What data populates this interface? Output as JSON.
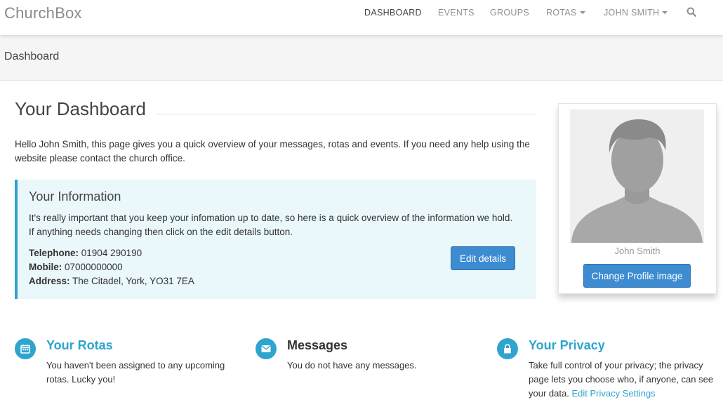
{
  "navbar": {
    "brand": "ChurchBox",
    "items": [
      {
        "label": "DASHBOARD",
        "active": true
      },
      {
        "label": "EVENTS"
      },
      {
        "label": "GROUPS"
      },
      {
        "label": "ROTAS",
        "dropdown": true
      },
      {
        "label": "JOHN SMITH",
        "dropdown": true
      }
    ],
    "search_icon": "search-icon"
  },
  "band": {
    "title": "Dashboard"
  },
  "main": {
    "title": "Your Dashboard",
    "intro": "Hello John Smith, this page gives you a quick overview of your messages, rotas and events. If you need any help using the website please contact the church office."
  },
  "info": {
    "title": "Your Information",
    "description": "It's really important that you keep your infomation up to date, so here is a quick overview of the information we hold. If anything needs changing then click on the edit details button.",
    "fields": [
      {
        "label": "Telephone:",
        "value": "01904 290190"
      },
      {
        "label": "Mobile:",
        "value": "07000000000"
      },
      {
        "label": "Address:",
        "value": "The Citadel, York, YO31 7EA"
      }
    ],
    "edit_button": "Edit details"
  },
  "profile": {
    "name": "John Smith",
    "button": "Change Profile image"
  },
  "features": {
    "rotas": {
      "icon": "calendar-icon",
      "title": "Your Rotas",
      "text": "You haven't been assigned to any upcoming rotas. Lucky you!"
    },
    "messages": {
      "icon": "envelope-icon",
      "title": "Messages",
      "text": "You do not have any messages."
    },
    "privacy": {
      "icon": "lock-icon",
      "title": "Your Privacy",
      "text": "Take full control of your privacy; the privacy page lets you choose who, if anyone, can see your data.",
      "link": "Edit Privacy Settings"
    }
  },
  "colors": {
    "accent": "#2fa4cf",
    "button": "#3d8bd0",
    "info_bg": "#eaf7fb"
  }
}
